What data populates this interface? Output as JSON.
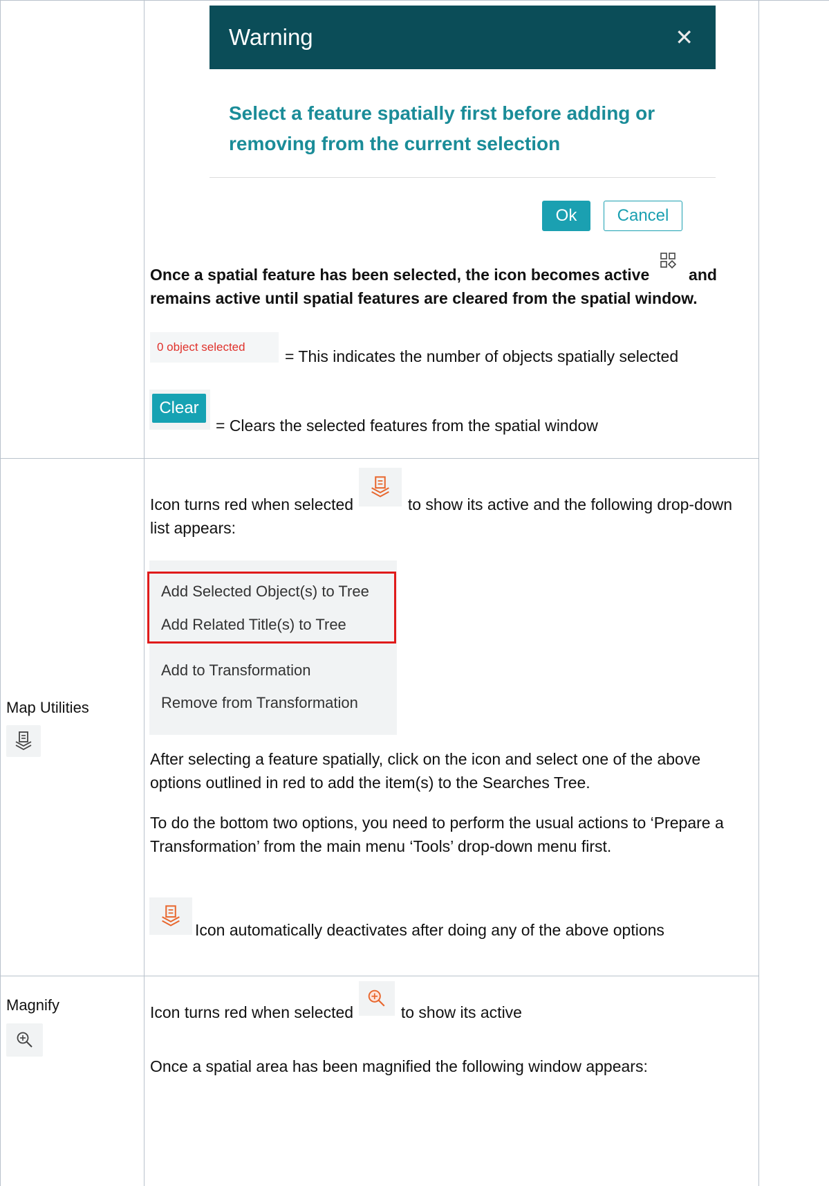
{
  "rows": {
    "selection_warning": {
      "dialog": {
        "title": "Warning",
        "close_glyph": "✕",
        "message": "Select a feature spatially first before adding or removing from the current selection",
        "ok_label": "Ok",
        "cancel_label": "Cancel"
      },
      "active_note": {
        "text_before": "Once a spatial feature has been selected, the icon becomes active",
        "text_after": "and remains active until spatial features are cleared from the spatial window.",
        "icon": "select-add-icon"
      },
      "object_count": {
        "chip_text": "0 object selected",
        "description": "= This indicates the number of objects spatially selected"
      },
      "clear": {
        "button_label": "Clear",
        "description": "= Clears the selected features from the spatial window"
      }
    },
    "map_utilities": {
      "label": "Map Utilities",
      "icon": "map-utilities-icon",
      "intro_before": "Icon turns red when selected",
      "intro_after": "to show its active and the following drop-down list appears:",
      "menu_items": [
        "Add Selected Object(s) to Tree",
        "Add Related Title(s) to Tree",
        "Add to Transformation",
        "Remove from Transformation"
      ],
      "para1": "After selecting a feature spatially, click on the icon and select one of the above options outlined in red to add the item(s) to the Searches Tree.",
      "para2": "To do the bottom two options, you need to perform the usual actions to ‘Prepare a Transformation’ from the main menu ‘Tools’ drop-down menu first.",
      "para3": "Icon automatically deactivates after doing any of the above options"
    },
    "magnify": {
      "label": "Magnify",
      "icon": "magnify-icon",
      "intro_before": "Icon turns red when selected",
      "intro_after": "to show its active",
      "para1": "Once a spatial area has been magnified the following window appears:"
    }
  },
  "colors": {
    "dialog_header": "#0b4d58",
    "accent_teal": "#1ba0b1",
    "active_red": "#e8672e",
    "outline_red": "#e01b1b",
    "grid": "#b9c2cc"
  }
}
